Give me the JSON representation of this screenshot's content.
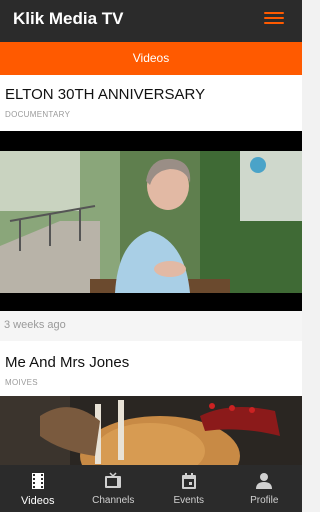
{
  "app": {
    "title": "Klik Media TV"
  },
  "section": {
    "title": "Videos"
  },
  "feed": [
    {
      "title": "ELTON 30TH ANNIVERSARY",
      "category": "DOCUMENTARY",
      "time_ago": "3 weeks ago"
    },
    {
      "title": "Me And Mrs Jones",
      "category": "MOIVES"
    }
  ],
  "nav": {
    "tabs": [
      {
        "label": "Videos",
        "icon": "film-icon",
        "active": true
      },
      {
        "label": "Channels",
        "icon": "tv-icon",
        "active": false
      },
      {
        "label": "Events",
        "icon": "calendar-icon",
        "active": false
      },
      {
        "label": "Profile",
        "icon": "person-icon",
        "active": false
      }
    ]
  },
  "colors": {
    "accent": "#ff5a00",
    "bar": "#2b2b2b"
  }
}
